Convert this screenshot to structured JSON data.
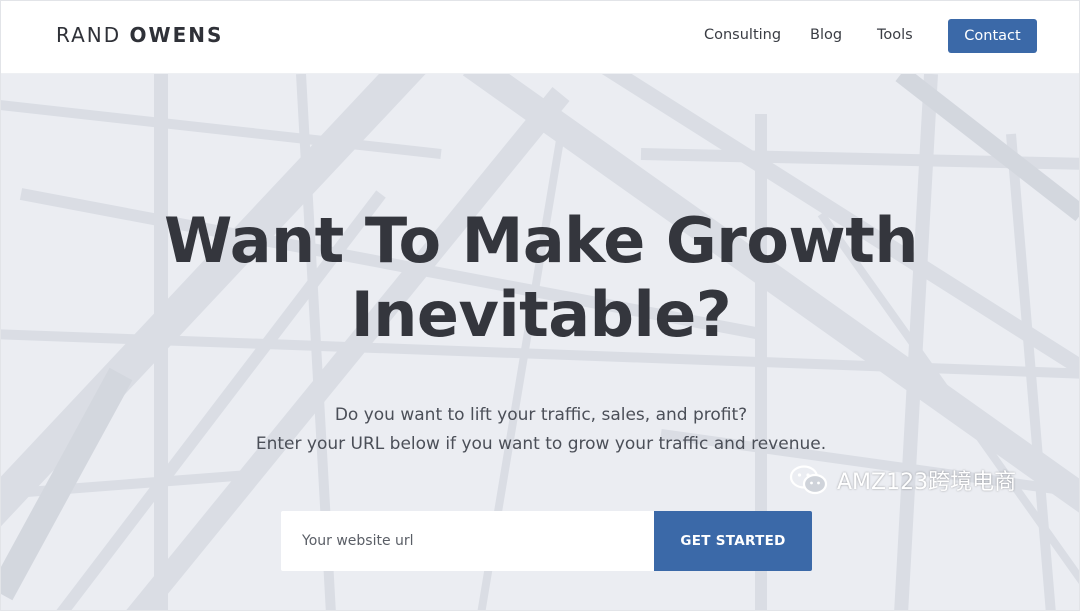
{
  "header": {
    "logo_light": "RAND",
    "logo_bold": "OWENS",
    "nav": {
      "consulting": "Consulting",
      "blog": "Blog",
      "tools": "Tools",
      "contact": "Contact"
    }
  },
  "hero": {
    "headline_line1": "Want To Make Growth",
    "headline_line2": "Inevitable?",
    "subtext_line1": "Do you want to lift your traffic, sales, and profit?",
    "subtext_line2": "Enter your URL below if you want to grow your traffic and revenue.",
    "url_placeholder": "Your website url",
    "cta_label": "GET STARTED"
  },
  "watermark": {
    "text": "AMZ123跨境电商"
  },
  "colors": {
    "accent": "#3b69a8",
    "headline": "#34363d",
    "hero_bg": "#e8ebf0"
  },
  "icons": {
    "watermark_icon": "wechat-icon"
  }
}
